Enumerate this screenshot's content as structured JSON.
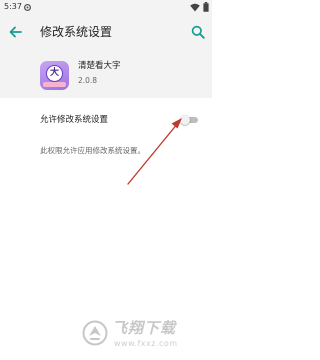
{
  "status_bar": {
    "time": "5:37",
    "icons": [
      "settings-icon",
      "wifi-icon",
      "battery-icon"
    ]
  },
  "app_bar": {
    "title": "修改系统设置",
    "back_icon": "arrow-back-icon",
    "search_icon": "search-icon"
  },
  "app_info": {
    "name": "清楚看大字",
    "version": "2.0.8",
    "icon_glyph": "大"
  },
  "permission": {
    "label": "允许修改系统设置",
    "description": "此权限允许应用修改系统设置。",
    "enabled": false
  },
  "watermark": {
    "title": "飞翔下载",
    "url": "www.fxxz.com"
  },
  "colors": {
    "accent": "#1a9e8f",
    "background": "#f3f3f3",
    "toggle_track": "#bdbdbd",
    "annotation_arrow": "#c0392b"
  }
}
